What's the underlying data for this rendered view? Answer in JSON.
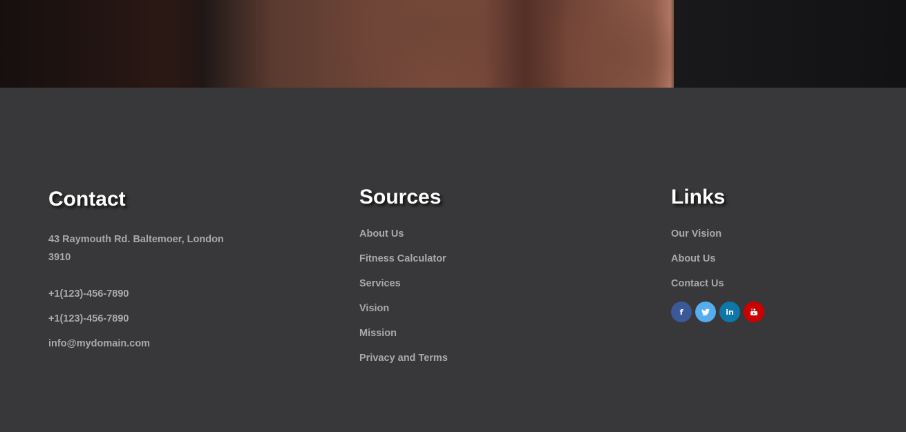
{
  "contact": {
    "heading": "Contact",
    "address": "43 Raymouth Rd. Baltemoer, London 3910",
    "phone_1": "+1(123)-456-7890",
    "phone_2": "+1(123)-456-7890",
    "email": "info@mydomain.com"
  },
  "sources": {
    "heading": "Sources",
    "items": [
      {
        "label": "About Us"
      },
      {
        "label": "Fitness Calculator"
      },
      {
        "label": "Services"
      },
      {
        "label": "Vision"
      },
      {
        "label": "Mission"
      },
      {
        "label": "Privacy and Terms"
      }
    ]
  },
  "links": {
    "heading": "Links",
    "items": [
      {
        "label": "Our Vision"
      },
      {
        "label": "About Us"
      },
      {
        "label": "Contact Us"
      }
    ],
    "social": [
      {
        "name": "facebook-icon",
        "glyph": "f",
        "color": "#3b5998"
      },
      {
        "name": "twitter-icon",
        "glyph": "t",
        "color": "#55acee"
      },
      {
        "name": "linkedin-icon",
        "glyph": "in",
        "color": "#0e76a8"
      },
      {
        "name": "youtube-icon",
        "glyph": "▶",
        "color": "#cc0000"
      }
    ]
  },
  "colors": {
    "footer_bg": "#38383a",
    "heading": "#ffffff",
    "link_text": "#a9a9ac"
  }
}
